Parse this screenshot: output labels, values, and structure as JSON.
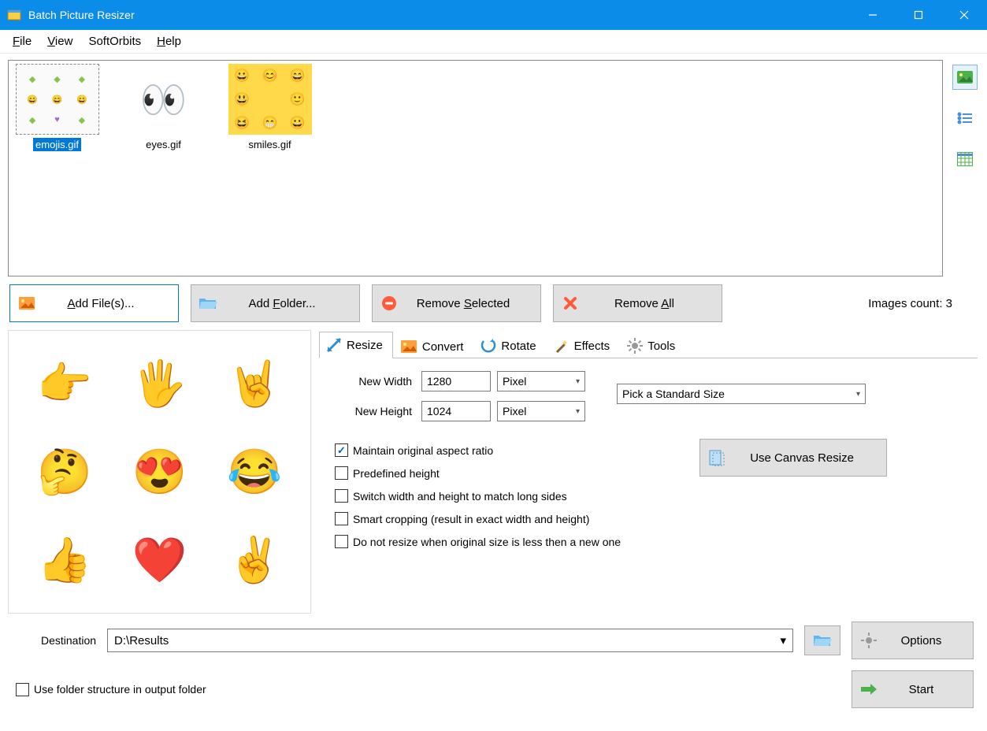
{
  "title": "Batch Picture Resizer",
  "menu": {
    "file": "File",
    "view": "View",
    "softorbits": "SoftOrbits",
    "help": "Help"
  },
  "thumbs": [
    {
      "name": "emojis.gif",
      "selected": true
    },
    {
      "name": "eyes.gif",
      "selected": false
    },
    {
      "name": "smiles.gif",
      "selected": false
    }
  ],
  "buttons": {
    "addfiles": "Add File(s)...",
    "addfolder": "Add Folder...",
    "removeselected": "Remove Selected",
    "removeall": "Remove All"
  },
  "count_label": "Images count: 3",
  "tabs": {
    "resize": "Resize",
    "convert": "Convert",
    "rotate": "Rotate",
    "effects": "Effects",
    "tools": "Tools"
  },
  "resize": {
    "width_label": "New Width",
    "width_value": "1280",
    "width_unit": "Pixel",
    "height_label": "New Height",
    "height_value": "1024",
    "height_unit": "Pixel",
    "standard_size": "Pick a Standard Size",
    "maintain": "Maintain original aspect ratio",
    "predefined": "Predefined height",
    "switch": "Switch width and height to match long sides",
    "smart": "Smart cropping (result in exact width and height)",
    "donot": "Do not resize when original size is less then a new one",
    "canvas": "Use Canvas Resize"
  },
  "destination": {
    "label": "Destination",
    "value": "D:\\Results",
    "folderchk": "Use folder structure in output folder"
  },
  "footer": {
    "options": "Options",
    "start": "Start"
  }
}
